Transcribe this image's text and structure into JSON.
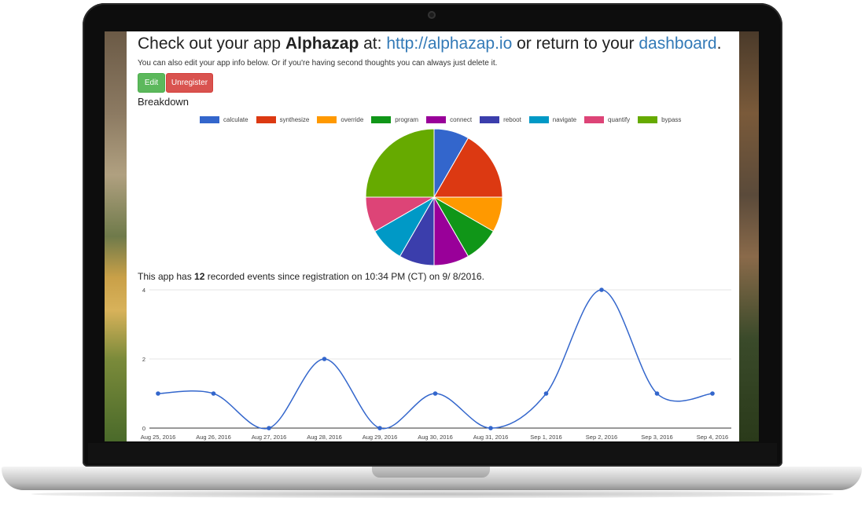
{
  "page": {
    "headline_prefix": "Check out your app ",
    "app_name": "Alphazap",
    "headline_mid": " at: ",
    "app_url": "http://alphazap.io",
    "headline_or": " or return to your ",
    "dashboard_link": "dashboard",
    "headline_end": ".",
    "subtext": "You can also edit your app info below. Or if you're having second thoughts you can always just delete it.",
    "edit_label": "Edit",
    "unregister_label": "Unregister",
    "breakdown_title": "Breakdown",
    "events_prefix": "This app has ",
    "events_count": "12",
    "events_suffix": " recorded events since registration on 10:34 PM (CT) on 9/ 8/2016."
  },
  "chart_data": [
    {
      "type": "pie",
      "title": "",
      "legend_position": "top",
      "categories": [
        "calculate",
        "synthesize",
        "override",
        "program",
        "connect",
        "reboot",
        "navigate",
        "quantify",
        "bypass"
      ],
      "values": [
        1,
        2,
        1,
        1,
        1,
        1,
        1,
        1,
        3
      ],
      "colors": [
        "#3366cc",
        "#dc3912",
        "#ff9900",
        "#109618",
        "#990099",
        "#3b3eac",
        "#0099c6",
        "#dd4477",
        "#66aa00"
      ]
    },
    {
      "type": "line",
      "title": "",
      "xlabel": "",
      "ylabel": "",
      "categories": [
        "Aug 25, 2016",
        "Aug 26, 2016",
        "Aug 27, 2016",
        "Aug 28, 2016",
        "Aug 29, 2016",
        "Aug 30, 2016",
        "Aug 31, 2016",
        "Sep 1, 2016",
        "Sep 2, 2016",
        "Sep 3, 2016",
        "Sep 4, 2016"
      ],
      "series": [
        {
          "values": [
            1,
            1,
            0,
            2,
            0,
            1,
            0,
            1,
            4,
            1,
            1
          ]
        }
      ],
      "yticks": [
        0,
        2,
        4
      ],
      "ylim": [
        0,
        4
      ],
      "grid": true,
      "curve": "smooth",
      "color": "#3366cc"
    }
  ]
}
